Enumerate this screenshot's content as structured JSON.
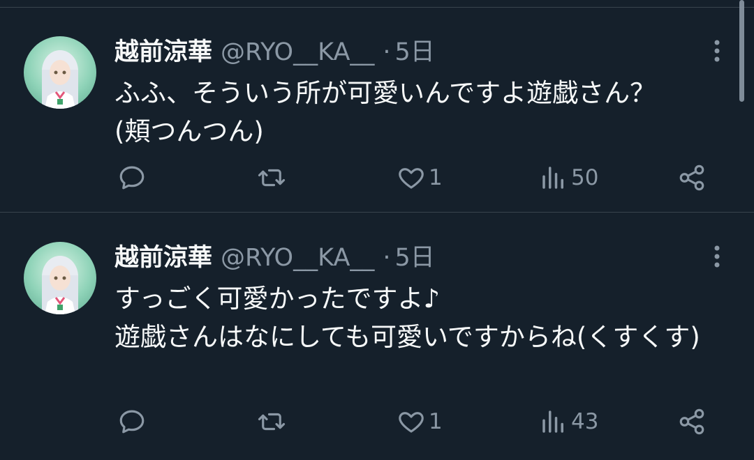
{
  "tweets": [
    {
      "name": "越前涼華",
      "handle": "@RYO__KA__",
      "dot": "·",
      "time": "5日",
      "text": "ふふ、そういう所が可愛いんですよ遊戯さん？\n(頬つんつん)",
      "likes": "1",
      "views": "50"
    },
    {
      "name": "越前涼華",
      "handle": "@RYO__KA__",
      "dot": "·",
      "time": "5日",
      "text": "すっごく可愛かったですよ♪\n遊戯さんはなにしても可愛いですからね(くすくす)",
      "likes": "1",
      "views": "43"
    }
  ],
  "icons": [
    "more-vertical-icon",
    "reply-icon",
    "retweet-icon",
    "like-icon",
    "views-icon",
    "share-icon"
  ],
  "colors": {
    "background": "#15202b",
    "text": "#f7f9f9",
    "secondary": "#8b98a5",
    "divider": "#38444d"
  }
}
